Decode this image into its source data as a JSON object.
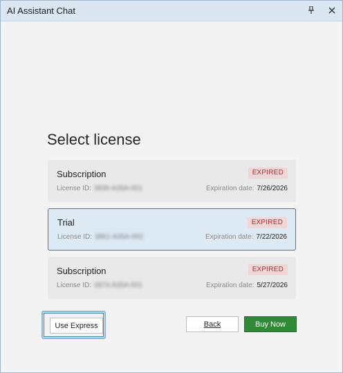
{
  "window": {
    "title": "AI Assistant Chat",
    "pin_icon": "pin-icon",
    "close_icon": "close-icon"
  },
  "heading": "Select license",
  "licenses": [
    {
      "type": "Subscription",
      "status": "EXPIRED",
      "id_label": "License ID:",
      "id_value": "3836-A35A-001",
      "exp_label": "Expiration date:",
      "exp_date": "7/26/2026",
      "selected": false
    },
    {
      "type": "Trial",
      "status": "EXPIRED",
      "id_label": "License ID:",
      "id_value": "3861-A35A-002",
      "exp_label": "Expiration date:",
      "exp_date": "7/22/2026",
      "selected": true
    },
    {
      "type": "Subscription",
      "status": "EXPIRED",
      "id_label": "License ID:",
      "id_value": "3874-A35A-001",
      "exp_label": "Expiration date:",
      "exp_date": "5/27/2026",
      "selected": false
    }
  ],
  "buttons": {
    "express": "Use Express",
    "back": "Back",
    "buy": "Buy Now"
  },
  "colors": {
    "selected_border": "#2e7fc0",
    "buy_button": "#2f8a35",
    "expired_badge": "#b52b2b"
  }
}
